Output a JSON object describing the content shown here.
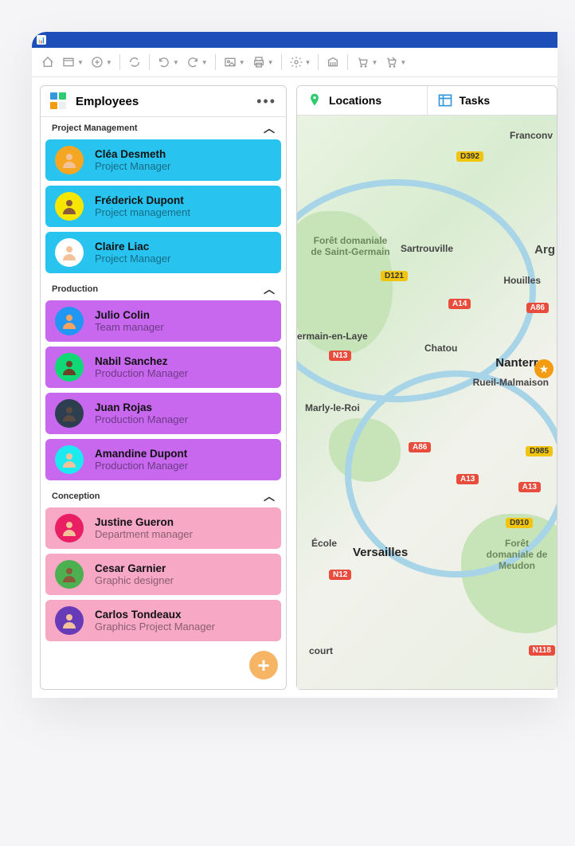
{
  "app": {
    "title": ""
  },
  "left_panel": {
    "title": "Employees",
    "groups": [
      {
        "name": "Project Management",
        "color": "#29c3ef",
        "employees": [
          {
            "name": "Cléa Desmeth",
            "role": "Project Manager",
            "avatar_bg": "#f5a623"
          },
          {
            "name": "Fréderick Dupont",
            "role": "Project management",
            "avatar_bg": "#f7e600"
          },
          {
            "name": "Claire Liac",
            "role": "Project Manager",
            "avatar_bg": "#ffffff"
          }
        ]
      },
      {
        "name": "Production",
        "color": "#c768ef",
        "employees": [
          {
            "name": "Julio Colin",
            "role": "Team manager",
            "avatar_bg": "#2196f3"
          },
          {
            "name": "Nabil Sanchez",
            "role": "Production Manager",
            "avatar_bg": "#10d876"
          },
          {
            "name": "Juan Rojas",
            "role": "Production Manager",
            "avatar_bg": "#2c3e50"
          },
          {
            "name": "Amandine Dupont",
            "role": "Production Manager",
            "avatar_bg": "#1de9f0"
          }
        ]
      },
      {
        "name": "Conception",
        "color": "#f7a8c4",
        "employees": [
          {
            "name": "Justine Gueron",
            "role": "Department manager",
            "avatar_bg": "#e91e63"
          },
          {
            "name": "Cesar Garnier",
            "role": "Graphic designer",
            "avatar_bg": "#4caf50"
          },
          {
            "name": "Carlos Tondeaux",
            "role": "Graphics Project Manager",
            "avatar_bg": "#673ab7"
          }
        ]
      }
    ]
  },
  "right_panel": {
    "tabs": [
      {
        "label": "Locations"
      },
      {
        "label": "Tasks"
      }
    ],
    "map": {
      "cities": [
        "Nanterre",
        "Versailles"
      ],
      "labels": [
        "Franconv",
        "Sartrouville",
        "Arg",
        "Houilles",
        "Rueil-Malmaison",
        "Chatou",
        "Marly-le-Roi",
        "court",
        "Forêt domaniale de Saint-Germain",
        "ermain-en-Laye",
        "École",
        "Forêt domaniale de Meudon"
      ],
      "roads_red": [
        "A14",
        "A86",
        "A86",
        "A13",
        "A13",
        "N13",
        "N12",
        "N118"
      ],
      "roads_yellow": [
        "D392",
        "D121",
        "D985",
        "D910"
      ]
    }
  }
}
